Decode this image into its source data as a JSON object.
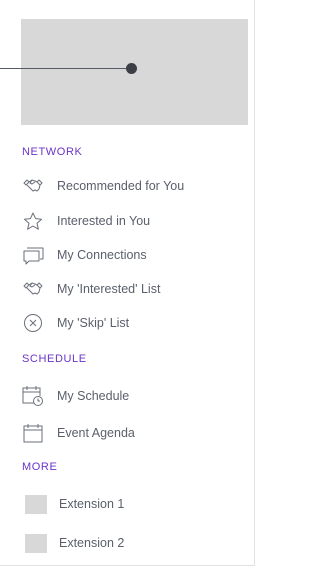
{
  "sections": {
    "network": {
      "heading": "NETWORK",
      "items": [
        {
          "label": "Recommended for You",
          "icon": "handshake-icon"
        },
        {
          "label": "Interested in You",
          "icon": "star-icon"
        },
        {
          "label": "My Connections",
          "icon": "chat-bubbles-icon"
        },
        {
          "label": "My 'Interested' List",
          "icon": "handshake-icon"
        },
        {
          "label": "My 'Skip' List",
          "icon": "close-circle-icon"
        }
      ]
    },
    "schedule": {
      "heading": "SCHEDULE",
      "items": [
        {
          "label": "My Schedule",
          "icon": "calendar-clock-icon"
        },
        {
          "label": "Event Agenda",
          "icon": "calendar-icon"
        }
      ]
    },
    "more": {
      "heading": "MORE",
      "items": [
        {
          "label": "Extension 1",
          "icon": "placeholder-square"
        },
        {
          "label": "Extension 2",
          "icon": "placeholder-square"
        }
      ]
    }
  },
  "colors": {
    "accent": "#6b35c9",
    "text": "#5a5f6b",
    "placeholder": "#d8d8d8"
  }
}
